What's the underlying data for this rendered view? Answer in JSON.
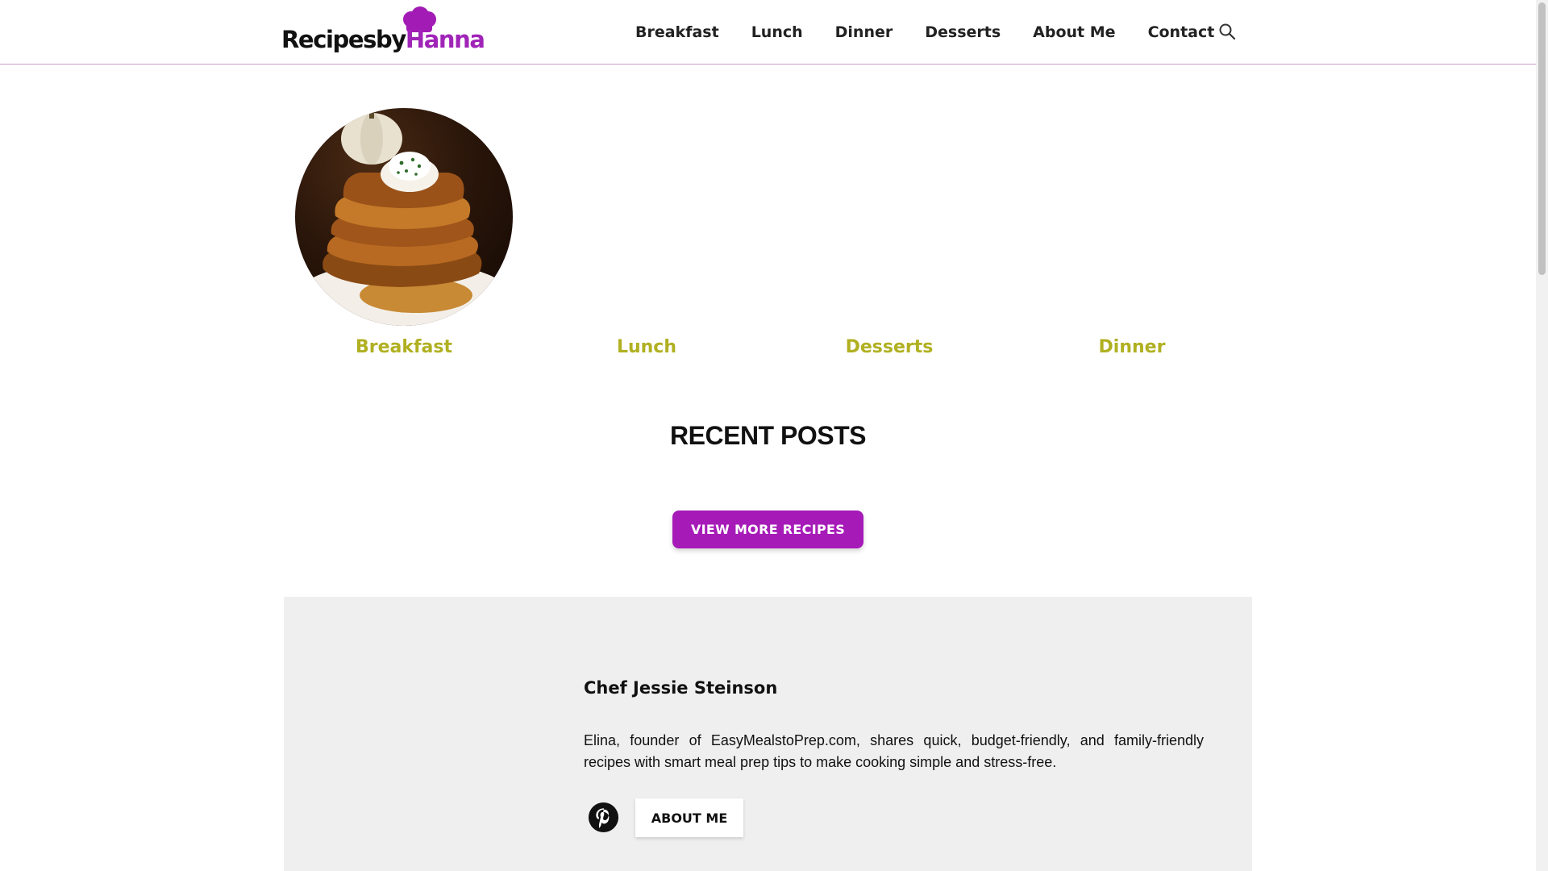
{
  "header": {
    "logo": {
      "part1": "Recipesby",
      "part2": "Hanna"
    },
    "nav": [
      "Breakfast",
      "Lunch",
      "Dinner",
      "Desserts",
      "About Me",
      "Contact"
    ],
    "search_icon": "search-icon"
  },
  "categories": [
    {
      "label": "Breakfast"
    },
    {
      "label": "Lunch"
    },
    {
      "label": "Desserts"
    },
    {
      "label": "Dinner"
    }
  ],
  "recent_posts": {
    "heading": "RECENT POSTS",
    "button": "VIEW MORE RECIPES"
  },
  "about": {
    "name": "Chef Jessie Steinson",
    "bio": "Elina, founder of EasyMealstoPrep.com, shares quick, budget-friendly, and family-friendly recipes with smart meal prep tips to make cooking simple and stress-free.",
    "button": "ABOUT ME",
    "social_icon": "pinterest-icon"
  },
  "colors": {
    "brand_purple": "#a61bb8",
    "category_label": "#b0b021",
    "about_bg": "#efefef"
  }
}
